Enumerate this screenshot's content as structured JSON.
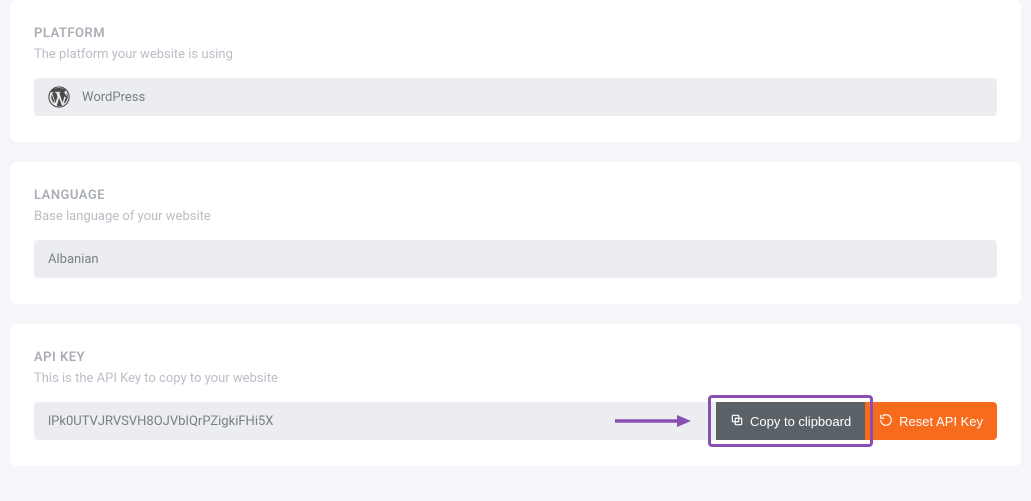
{
  "platform": {
    "title": "PLATFORM",
    "subtitle": "The platform your website is using",
    "value": "WordPress"
  },
  "language": {
    "title": "LANGUAGE",
    "subtitle": "Base language of your website",
    "value": "Albanian"
  },
  "apikey": {
    "title": "API KEY",
    "subtitle": "This is the API Key to copy to your website",
    "value": "lPk0UTVJRVSVH8OJVbIQrPZigkiFHi5X",
    "copy_label": "Copy to clipboard",
    "reset_label": "Reset API Key"
  },
  "annotations": {
    "highlight_color": "#8a4fb3"
  }
}
